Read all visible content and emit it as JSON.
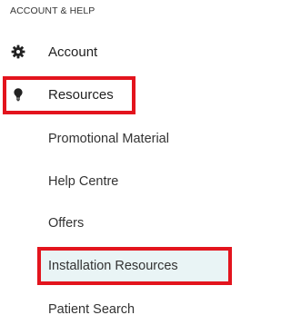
{
  "section": {
    "title": "ACCOUNT & HELP"
  },
  "nav": {
    "account": {
      "label": "Account",
      "icon": "gear-icon"
    },
    "resources": {
      "label": "Resources",
      "icon": "lightbulb-icon"
    }
  },
  "submenu": {
    "items": [
      {
        "label": "Promotional Material"
      },
      {
        "label": "Help Centre"
      },
      {
        "label": "Offers"
      },
      {
        "label": "Installation Resources",
        "selected": true
      },
      {
        "label": "Patient Search"
      }
    ]
  },
  "colors": {
    "highlight_border": "#e3141d",
    "selected_background": "#e9f4f5",
    "text": "#222222"
  }
}
